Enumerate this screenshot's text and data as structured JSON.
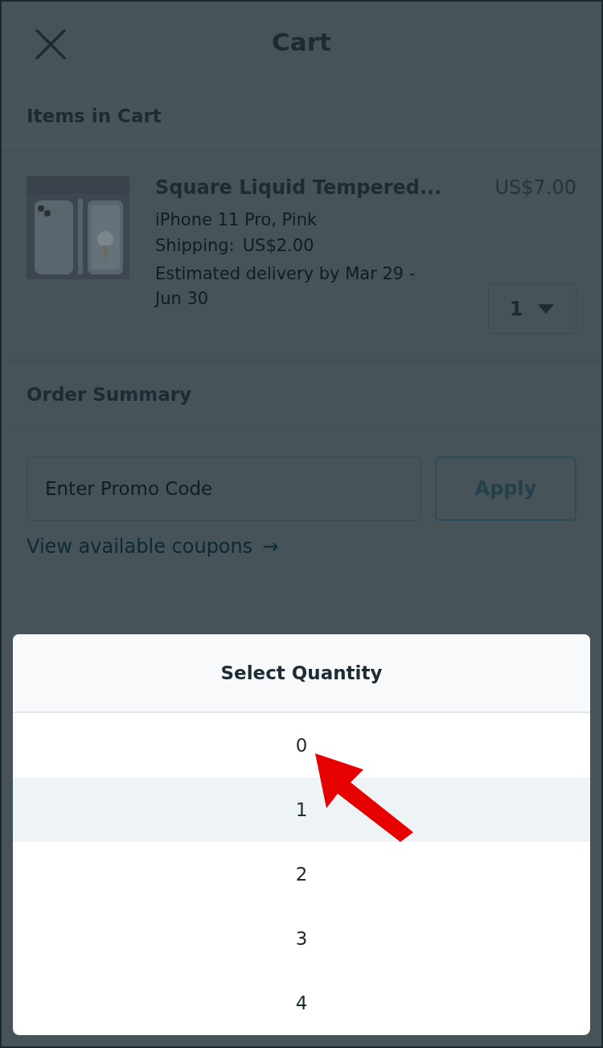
{
  "header": {
    "title": "Cart"
  },
  "items_section": {
    "title": "Items in Cart"
  },
  "cart_items": [
    {
      "name": "Square Liquid Tempered...",
      "variant": "iPhone 11 Pro, Pink",
      "shipping_label": "Shipping:",
      "shipping_price": "US$2.00",
      "delivery": "Estimated delivery by Mar 29 - Jun 30",
      "price": "US$7.00",
      "quantity": "1"
    }
  ],
  "order_summary": {
    "title": "Order Summary",
    "promo": {
      "placeholder": "Enter Promo Code"
    },
    "apply_button": "Apply",
    "coupons_link": "View available coupons",
    "coupons_arrow": "→"
  },
  "quantity_sheet": {
    "title": "Select Quantity",
    "options": [
      {
        "label": "0",
        "selected": false
      },
      {
        "label": "1",
        "selected": true
      },
      {
        "label": "2",
        "selected": false
      },
      {
        "label": "3",
        "selected": false
      },
      {
        "label": "4",
        "selected": false
      }
    ]
  }
}
